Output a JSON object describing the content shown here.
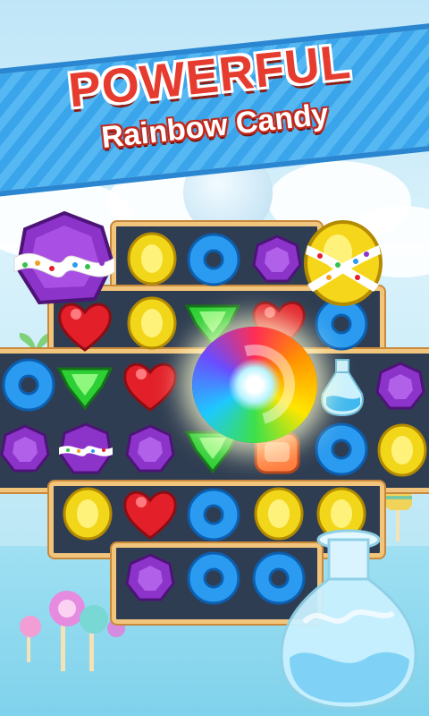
{
  "banner": {
    "title": "POWERFUL",
    "subtitle": "Rainbow Candy"
  },
  "colors": {
    "title_red": "#e63b2f",
    "banner_blue": "#3aa5ea",
    "board_frame": "#f2c57c",
    "board_fill": "#2f3d52"
  },
  "board": {
    "grid": [
      [
        "",
        "yellow-oval",
        "blue-donut",
        "purple-hex",
        "",
        ""
      ],
      [
        "red-heart",
        "yellow-oval",
        "green-gem",
        "red-heart",
        "blue-donut",
        ""
      ],
      [
        "blue-donut",
        "green-gem",
        "red-heart",
        "rainbow",
        "",
        "potion-bottle",
        "purple-hex"
      ],
      [
        "purple-hex",
        "purple-wrapped",
        "purple-hex",
        "green-gem",
        "orange-square",
        "blue-donut",
        "yellow-oval"
      ],
      [
        "",
        "yellow-oval",
        "red-heart",
        "blue-donut",
        "yellow-oval",
        "yellow-oval",
        ""
      ],
      [
        "",
        "",
        "purple-hex",
        "blue-donut",
        "blue-donut",
        "",
        ""
      ]
    ]
  },
  "specials": {
    "left": "purple-wrapped-candy",
    "right": "yellow-wrapped-candy",
    "center": "rainbow-candy",
    "corner": "potion-bottle"
  }
}
